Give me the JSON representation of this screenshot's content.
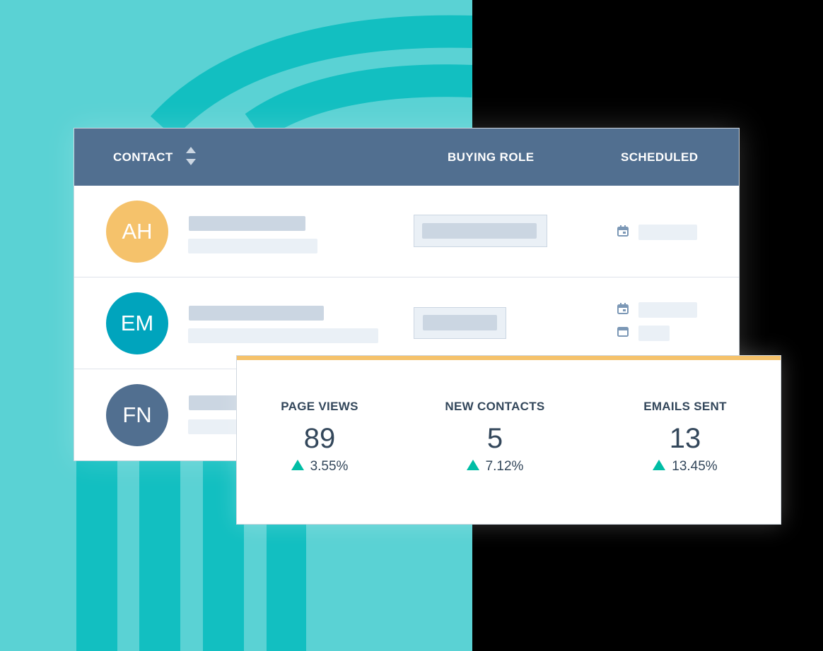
{
  "colors": {
    "header": "#516f90",
    "accent_bar": "#f5c26b",
    "trend_up": "#00bda5",
    "background_teal": "#5ad2d4"
  },
  "table": {
    "headers": {
      "contact": "CONTACT",
      "buying_role": "BUYING ROLE",
      "scheduled": "SCHEDULED"
    },
    "rows": [
      {
        "initials": "AH",
        "avatar_color": "#f5c26b",
        "scheduled_icons": [
          "calendar-icon"
        ]
      },
      {
        "initials": "EM",
        "avatar_color": "#00a4bd",
        "scheduled_icons": [
          "calendar-icon",
          "email-icon"
        ]
      },
      {
        "initials": "FN",
        "avatar_color": "#516f90",
        "scheduled_icons": []
      }
    ]
  },
  "stats": [
    {
      "label": "PAGE VIEWS",
      "value": "89",
      "change": "3.55%",
      "trend": "up"
    },
    {
      "label": "NEW CONTACTS",
      "value": "5",
      "change": "7.12%",
      "trend": "up"
    },
    {
      "label": "EMAILS SENT",
      "value": "13",
      "change": "13.45%",
      "trend": "up"
    }
  ]
}
